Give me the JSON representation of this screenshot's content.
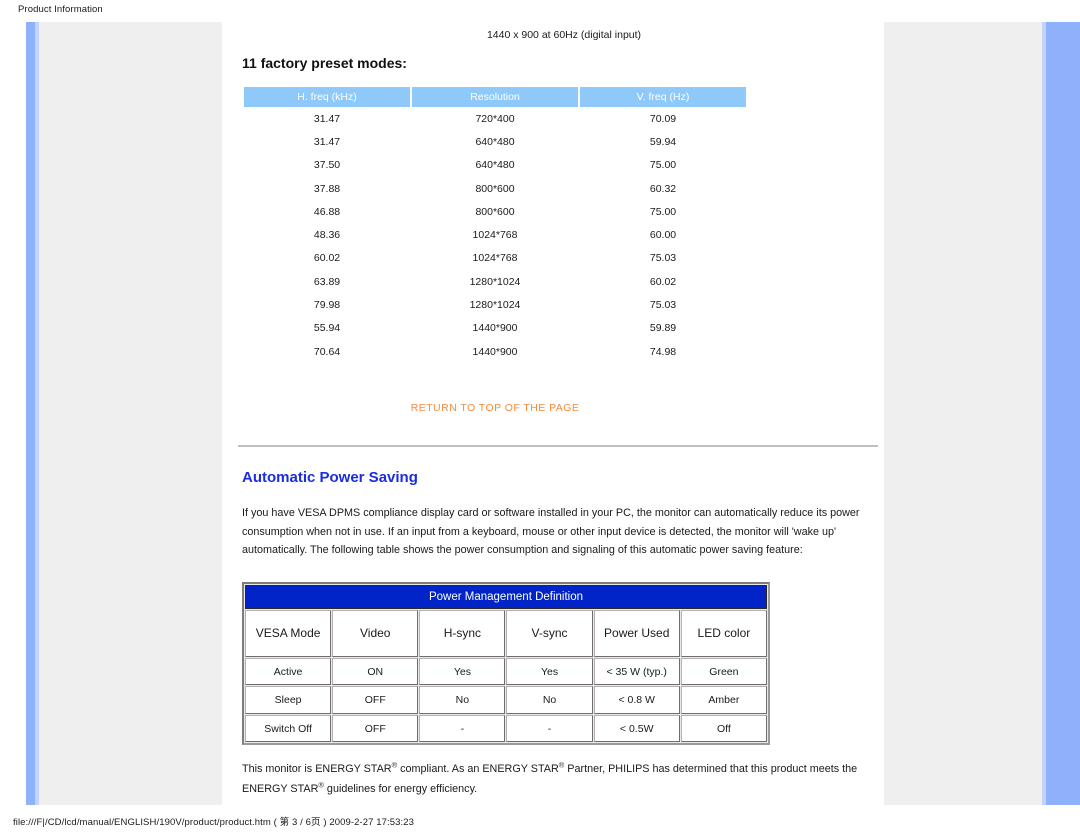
{
  "print_header": "Product Information",
  "print_footer": "file:///F|/CD/lcd/manual/ENGLISH/190V/product/product.htm ( 第 3 / 6页 ) 2009-2-27 17:53:23",
  "colors": {
    "preset_header_blue": "#8ec9f9",
    "pm_header_blue": "#0024c8",
    "section_heading_blue": "#1a2de0",
    "return_link_orange": "#f68b3c",
    "panel_gray": "#efefef",
    "panel_rail_blue": "#8fb0fb"
  },
  "resolution_note": "1440 x 900 at 60Hz (digital input)",
  "preset_heading": "11 factory preset modes:",
  "preset_table": {
    "columns": [
      "H. freq (kHz)",
      "Resolution",
      "V. freq (Hz)"
    ],
    "rows": [
      [
        "31.47",
        "720*400",
        "70.09"
      ],
      [
        "31.47",
        "640*480",
        "59.94"
      ],
      [
        "37.50",
        "640*480",
        "75.00"
      ],
      [
        "37.88",
        "800*600",
        "60.32"
      ],
      [
        "46.88",
        "800*600",
        "75.00"
      ],
      [
        "48.36",
        "1024*768",
        "60.00"
      ],
      [
        "60.02",
        "1024*768",
        "75.03"
      ],
      [
        "63.89",
        "1280*1024",
        "60.02"
      ],
      [
        "79.98",
        "1280*1024",
        "75.03"
      ],
      [
        "55.94",
        "1440*900",
        "59.89"
      ],
      [
        "70.64",
        "1440*900",
        "74.98"
      ]
    ]
  },
  "return_link": "RETURN TO TOP OF THE PAGE",
  "power_saving": {
    "heading": "Automatic Power Saving",
    "paragraph": "If you have VESA DPMS compliance display card or software installed in your PC, the monitor can automatically reduce its power consumption when not in use. If an input from a keyboard, mouse or other input device is detected, the monitor will 'wake up' automatically. The following table shows the power consumption and signaling of this automatic power saving feature:"
  },
  "pm_table": {
    "title": "Power Management Definition",
    "columns": [
      "VESA Mode",
      "Video",
      "H-sync",
      "V-sync",
      "Power Used",
      "LED color"
    ],
    "rows": [
      [
        "Active",
        "ON",
        "Yes",
        "Yes",
        "< 35 W (typ.)",
        "Green"
      ],
      [
        "Sleep",
        "OFF",
        "No",
        "No",
        "< 0.8 W",
        "Amber"
      ],
      [
        "Switch Off",
        "OFF",
        "-",
        "-",
        "< 0.5W",
        "Off"
      ]
    ]
  },
  "energy_star": {
    "line1_a": "This monitor is ENERGY STAR",
    "line1_b": " compliant. As an ENERGY STAR",
    "line1_c": " Partner, PHILIPS has determined that this",
    "line2_a": "product meets the ENERGY STAR",
    "line2_b": " guidelines for energy efficiency.",
    "reg_mark": "®"
  }
}
